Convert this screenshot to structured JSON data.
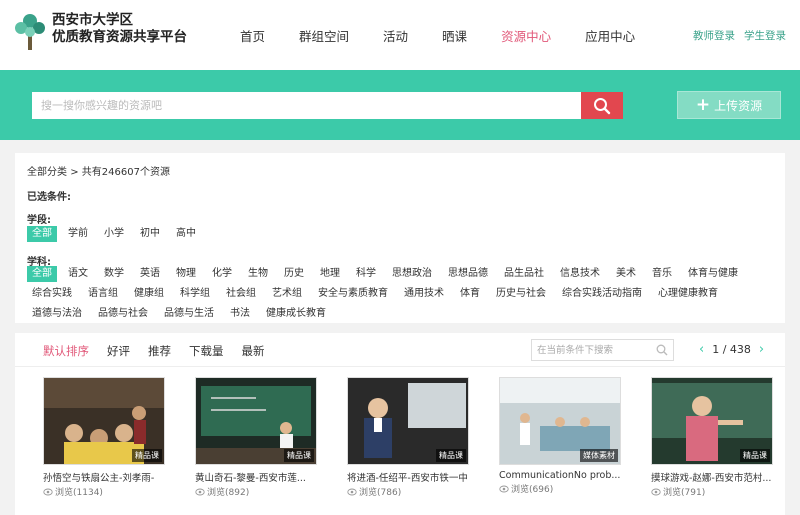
{
  "header": {
    "logo_line1": "西安市大学区",
    "logo_line2": "优质教育资源共享平台",
    "nav": [
      {
        "label": "首页",
        "active": false
      },
      {
        "label": "群组空间",
        "active": false
      },
      {
        "label": "活动",
        "active": false
      },
      {
        "label": "晒课",
        "active": false
      },
      {
        "label": "资源中心",
        "active": true
      },
      {
        "label": "应用中心",
        "active": false
      }
    ],
    "teacher_login": "教师登录",
    "student_login": "学生登录"
  },
  "search": {
    "placeholder": "搜一搜你感兴趣的资源吧",
    "upload_label": "上传资源"
  },
  "filter": {
    "crumb_all": "全部分类",
    "crumb_sep": ">",
    "crumb_count": "共有246607个资源",
    "selected_label": "已选条件:",
    "stage_label": "学段:",
    "stages": [
      "全部",
      "学前",
      "小学",
      "初中",
      "高中"
    ],
    "subject_label": "学科:",
    "subjects": [
      "全部",
      "语文",
      "数学",
      "英语",
      "物理",
      "化学",
      "生物",
      "历史",
      "地理",
      "科学",
      "思想政治",
      "思想品德",
      "品生品社",
      "信息技术",
      "美术",
      "音乐",
      "体育与健康",
      "综合实践",
      "语言组",
      "健康组",
      "科学组",
      "社会组",
      "艺术组",
      "安全与素质教育",
      "通用技术",
      "体育",
      "历史与社会",
      "综合实践活动指南",
      "心理健康教育",
      "道德与法治",
      "品德与社会",
      "品德与生活",
      "书法",
      "健康成长教育"
    ]
  },
  "results": {
    "sort_options": [
      {
        "label": "默认排序",
        "active": true
      },
      {
        "label": "好评",
        "active": false
      },
      {
        "label": "推荐",
        "active": false
      },
      {
        "label": "下载量",
        "active": false
      },
      {
        "label": "最新",
        "active": false
      }
    ],
    "in_search_placeholder": "在当前条件下搜索",
    "page_current": 1,
    "page_total": 438,
    "pager_text": "1 / 438",
    "cards": [
      {
        "title": "孙悟空与铁扇公主-刘孝雨-",
        "views": "浏览(1134)",
        "badge": "精品课"
      },
      {
        "title": "黄山奇石-黎曼-西安市莲...",
        "views": "浏览(892)",
        "badge": "精品课"
      },
      {
        "title": "将进酒-任绍平-西安市铁一中",
        "views": "浏览(786)",
        "badge": "精品课"
      },
      {
        "title": "CommunicationNo prob...",
        "views": "浏览(696)",
        "badge": "媒体素材"
      },
      {
        "title": "摸球游戏-赵娜-西安市范村...",
        "views": "浏览(791)",
        "badge": "精品课"
      }
    ]
  },
  "colors": {
    "accent": "#3ccaa9",
    "active_pink": "#e15778",
    "search_red": "#e2474f"
  }
}
